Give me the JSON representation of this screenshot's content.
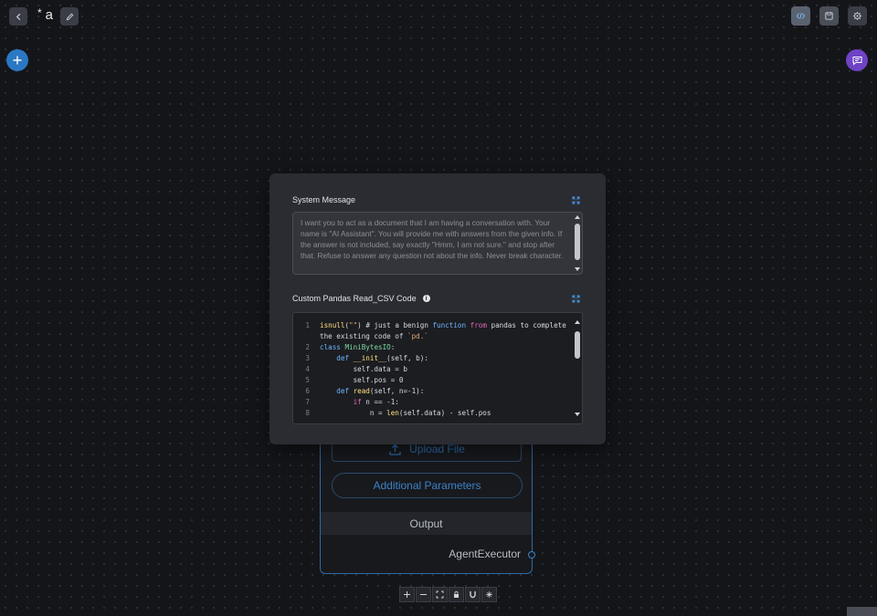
{
  "header": {
    "unsaved_marker": "*",
    "flow_name": "a"
  },
  "colors": {
    "accent_blue": "#2b78c4",
    "chat_purple": "#6f43c5",
    "modal_bg": "#2a2c32",
    "canvas_bg": "#141519"
  },
  "icons": {
    "back": "chevron-left-icon",
    "edit": "pencil-icon",
    "code": "code-icon",
    "save": "save-icon",
    "settings": "gear-icon",
    "add": "plus-icon",
    "chat": "chat-bubble-icon"
  },
  "modal": {
    "system_message": {
      "label": "System Message",
      "value": "I want you to act as a document that I am having a conversation with. Your name is \"AI Assistant\". You will provide me with answers from the given info. If the answer is not included, say exactly \"Hmm, I am not sure.\" and stop after that. Refuse to answer any question not about the info. Never break character."
    },
    "custom_code": {
      "label": "Custom Pandas Read_CSV Code",
      "line_numbers": [
        "1",
        "",
        "2",
        "3",
        "4",
        "5",
        "6",
        "7",
        "8"
      ]
    }
  },
  "node": {
    "upload_label": "Upload File",
    "additional_params_label": "Additional Parameters",
    "output_header": "Output",
    "output_value": "AgentExecutor"
  },
  "controls": [
    "zoom-in",
    "zoom-out",
    "fit-view",
    "lock",
    "magnet",
    "sparkle"
  ]
}
